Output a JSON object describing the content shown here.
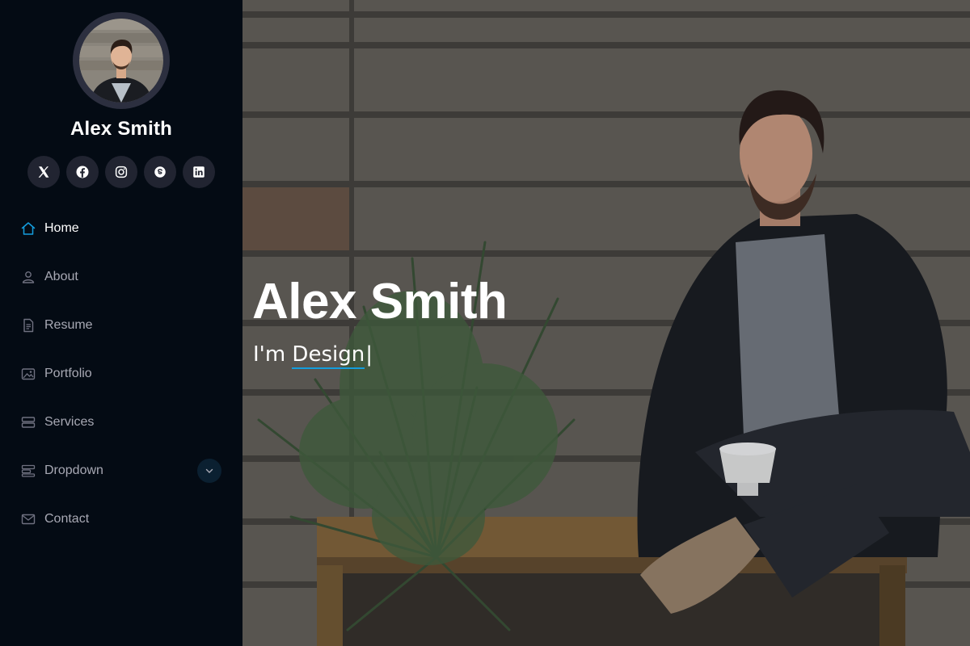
{
  "profile": {
    "name": "Alex Smith"
  },
  "socials": [
    {
      "icon": "x-twitter-icon"
    },
    {
      "icon": "facebook-icon"
    },
    {
      "icon": "instagram-icon"
    },
    {
      "icon": "skype-icon"
    },
    {
      "icon": "linkedin-icon"
    }
  ],
  "nav": {
    "items": [
      {
        "label": "Home",
        "icon": "home-icon",
        "active": true
      },
      {
        "label": "About",
        "icon": "person-icon"
      },
      {
        "label": "Resume",
        "icon": "file-text-icon"
      },
      {
        "label": "Portfolio",
        "icon": "images-icon"
      },
      {
        "label": "Services",
        "icon": "hdd-stack-icon"
      },
      {
        "label": "Dropdown",
        "icon": "menu-stack-icon",
        "has_submenu": true
      },
      {
        "label": "Contact",
        "icon": "envelope-icon"
      }
    ]
  },
  "hero": {
    "title": "Alex Smith",
    "subtitle_prefix": "I'm ",
    "typed_text": "Design",
    "cursor": "|"
  },
  "colors": {
    "sidebar_bg": "#040b14",
    "accent": "#149ddd",
    "nav_text": "#a8a9b4",
    "social_bg": "#212431"
  }
}
